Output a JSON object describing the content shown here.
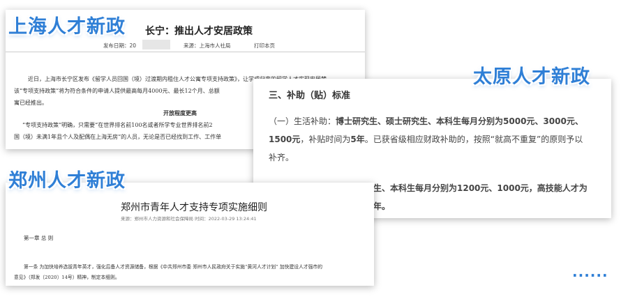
{
  "tags": {
    "shanghai": "上海人才新政",
    "taiyuan": "太原人才新政",
    "zhengzhou": "郑州人才新政"
  },
  "shanghai_doc": {
    "title": "长宁：推出人才安居政策",
    "date_label": "发布日期：20",
    "source": "来源：上海市人社局",
    "print": "打印本页",
    "lines": [
      "近日，上海市长宁区发布《留学人员回国（境）过渡期内租住人才公寓专项支持政策》，让学成归来的留学人才实现安居梦。",
      "该“专项支持政策”将为符合条件的申请人提供最高每月4000元、最长12个月、总额",
      "寓已经推出。"
    ],
    "subheading": "开放程度更高",
    "lines2": [
      "“专项支持政策”明确，只需要“在世界排名前100名或者所学专业世界排名前2",
      "国（境）未满1年且个人及配偶在上海无房”的人员，无论是否已经找到工作、工作单"
    ]
  },
  "taiyuan_doc": {
    "heading": "三、补助（贴）标准",
    "line1_prefix": "（一）生活补助：",
    "line1_bold": "博士研究生、硕士研究生、本科生每月分别为5000元、3000元、",
    "line2_bold": "1500元",
    "line2_mid": "，补贴时间为",
    "line2_bold2": "5年",
    "line2_rest": "。已获省级相应财政补助的，按照“就高不重复”的原则予以",
    "line3": "补齐。",
    "line4_bold": "生、本科生每月分别为1200元、1000元，高技能人才为",
    "line5_bold": "年。"
  },
  "zhengzhou_doc": {
    "title": "郑州市青年人才支持专项实施细则",
    "source": "来源：郑州市人力资源和社会保障局  时间：2022-03-29 13:24:41",
    "chapter": "第一章  总  则",
    "article_line1": "第一条  为加快培养选拔青年英才，强化后备人才资源储备，根据《中共郑州市委  郑州市人民政府关于实施“黄河人才计划”  加快建设人才强市的",
    "article_line2": "意见》（郑发〔2020〕14号）精神，制定本细则。"
  },
  "more": "......"
}
